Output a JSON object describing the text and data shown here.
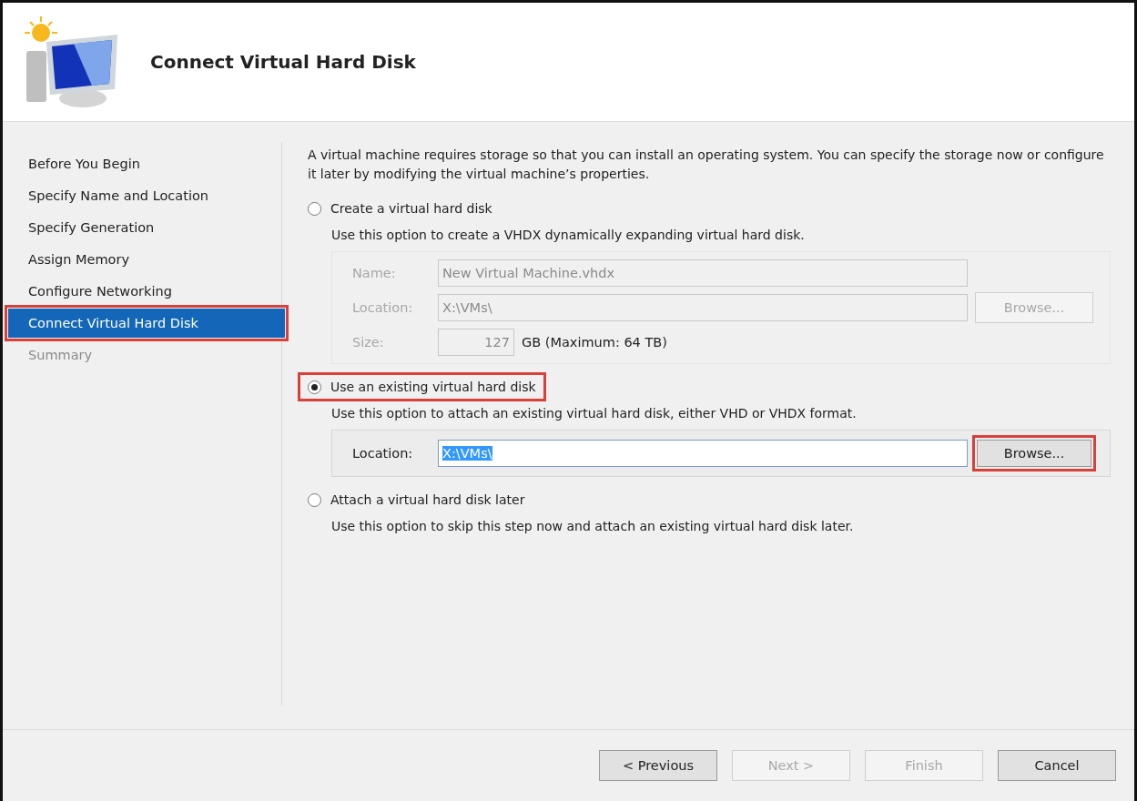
{
  "window": {
    "title": "Connect Virtual Hard Disk"
  },
  "steps": [
    {
      "label": "Before You Begin",
      "selected": false,
      "disabled": false,
      "highlighted": false
    },
    {
      "label": "Specify Name and Location",
      "selected": false,
      "disabled": false,
      "highlighted": false
    },
    {
      "label": "Specify Generation",
      "selected": false,
      "disabled": false,
      "highlighted": false
    },
    {
      "label": "Assign Memory",
      "selected": false,
      "disabled": false,
      "highlighted": false
    },
    {
      "label": "Configure Networking",
      "selected": false,
      "disabled": false,
      "highlighted": false
    },
    {
      "label": "Connect Virtual Hard Disk",
      "selected": true,
      "disabled": false,
      "highlighted": true
    },
    {
      "label": "Summary",
      "selected": false,
      "disabled": true,
      "highlighted": false
    }
  ],
  "intro": "A virtual machine requires storage so that you can install an operating system. You can specify the storage now or configure it later by modifying the virtual machine’s properties.",
  "options": [
    {
      "label": "Create a virtual hard disk",
      "selected": false,
      "highlighted": false,
      "disabled": true,
      "description": "Use this option to create a VHDX dynamically expanding virtual hard disk.",
      "fields": [
        {
          "kind": "text",
          "label": "Name:",
          "value": "New Virtual Machine.vhdx",
          "value_selected": false
        },
        {
          "kind": "browse",
          "label": "Location:",
          "value": "X:\\VMs\\",
          "value_selected": false,
          "button": "Browse...",
          "button_highlighted": false
        },
        {
          "kind": "size",
          "label": "Size:",
          "value": "127",
          "unit": "GB (Maximum: 64 TB)",
          "value_selected": false
        }
      ]
    },
    {
      "label": "Use an existing virtual hard disk",
      "selected": true,
      "highlighted": true,
      "disabled": false,
      "description": "Use this option to attach an existing virtual hard disk, either VHD or VHDX format.",
      "fields": [
        {
          "kind": "browse",
          "label": "Location:",
          "value": "X:\\VMs\\",
          "value_selected": true,
          "button": "Browse...",
          "button_highlighted": true
        }
      ]
    },
    {
      "label": "Attach a virtual hard disk later",
      "selected": false,
      "highlighted": false,
      "description": "Use this option to skip this step now and attach an existing virtual hard disk later."
    }
  ],
  "buttons": [
    {
      "label": "< Previous",
      "disabled": false
    },
    {
      "label": "Next >",
      "disabled": true
    },
    {
      "label": "Finish",
      "disabled": true
    },
    {
      "label": "Cancel",
      "disabled": false
    }
  ]
}
